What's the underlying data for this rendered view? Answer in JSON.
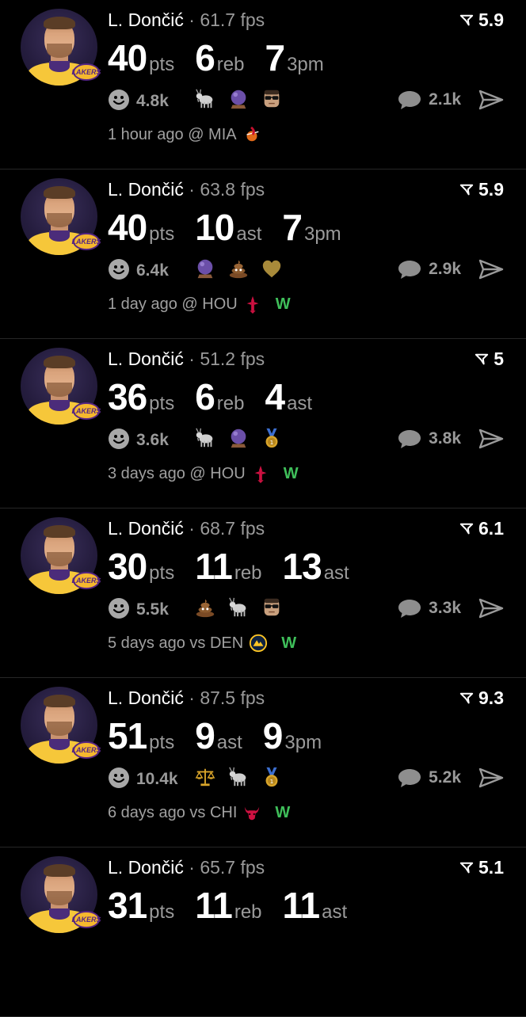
{
  "feed": {
    "separator": "·",
    "posts": [
      {
        "player": "L. Dončić",
        "fps": "61.7 fps",
        "score": "5.9",
        "stats": [
          {
            "value": "40",
            "label": "pts"
          },
          {
            "value": "6",
            "label": "reb"
          },
          {
            "value": "7",
            "label": "3pm"
          }
        ],
        "reactions": "4.8k",
        "emojis": [
          "goat-icon",
          "crystal-ball-icon",
          "cool-face-icon"
        ],
        "comments": "2.1k",
        "time": "1 hour ago @ MIA",
        "team_logo": "heat-logo-icon",
        "result": ""
      },
      {
        "player": "L. Dončić",
        "fps": "63.8 fps",
        "score": "5.9",
        "stats": [
          {
            "value": "40",
            "label": "pts"
          },
          {
            "value": "10",
            "label": "ast"
          },
          {
            "value": "7",
            "label": "3pm"
          }
        ],
        "reactions": "6.4k",
        "emojis": [
          "crystal-ball-icon",
          "poop-icon",
          "gold-heart-icon"
        ],
        "comments": "2.9k",
        "time": "1 day ago @ HOU",
        "team_logo": "rockets-logo-icon",
        "result": "W"
      },
      {
        "player": "L. Dončić",
        "fps": "51.2 fps",
        "score": "5",
        "stats": [
          {
            "value": "36",
            "label": "pts"
          },
          {
            "value": "6",
            "label": "reb"
          },
          {
            "value": "4",
            "label": "ast"
          }
        ],
        "reactions": "3.6k",
        "emojis": [
          "goat-icon",
          "crystal-ball-icon",
          "medal-icon"
        ],
        "comments": "3.8k",
        "time": "3 days ago @ HOU",
        "team_logo": "rockets-logo-icon",
        "result": "W"
      },
      {
        "player": "L. Dončić",
        "fps": "68.7 fps",
        "score": "6.1",
        "stats": [
          {
            "value": "30",
            "label": "pts"
          },
          {
            "value": "11",
            "label": "reb"
          },
          {
            "value": "13",
            "label": "ast"
          }
        ],
        "reactions": "5.5k",
        "emojis": [
          "poop-icon",
          "goat-icon",
          "cool-face-icon"
        ],
        "comments": "3.3k",
        "time": "5 days ago vs DEN",
        "team_logo": "nuggets-logo-icon",
        "result": "W"
      },
      {
        "player": "L. Dončić",
        "fps": "87.5 fps",
        "score": "9.3",
        "stats": [
          {
            "value": "51",
            "label": "pts"
          },
          {
            "value": "9",
            "label": "ast"
          },
          {
            "value": "9",
            "label": "3pm"
          }
        ],
        "reactions": "10.4k",
        "emojis": [
          "scales-icon",
          "goat-icon",
          "medal-icon"
        ],
        "comments": "5.2k",
        "time": "6 days ago vs CHI",
        "team_logo": "bulls-logo-icon",
        "result": "W"
      },
      {
        "player": "L. Dončić",
        "fps": "65.7 fps",
        "score": "5.1",
        "stats": [
          {
            "value": "31",
            "label": "pts"
          },
          {
            "value": "11",
            "label": "reb"
          },
          {
            "value": "11",
            "label": "ast"
          }
        ],
        "reactions": "",
        "emojis": [],
        "comments": "",
        "time": "",
        "team_logo": "",
        "result": ""
      }
    ]
  },
  "colors": {
    "background": "#000000",
    "muted": "#9a9a9a",
    "win": "#3fbf5a",
    "divider": "#262626",
    "lakers_gold": "#f5b82e",
    "lakers_purple": "#552583"
  },
  "badge": {
    "text": "LAKERS"
  }
}
